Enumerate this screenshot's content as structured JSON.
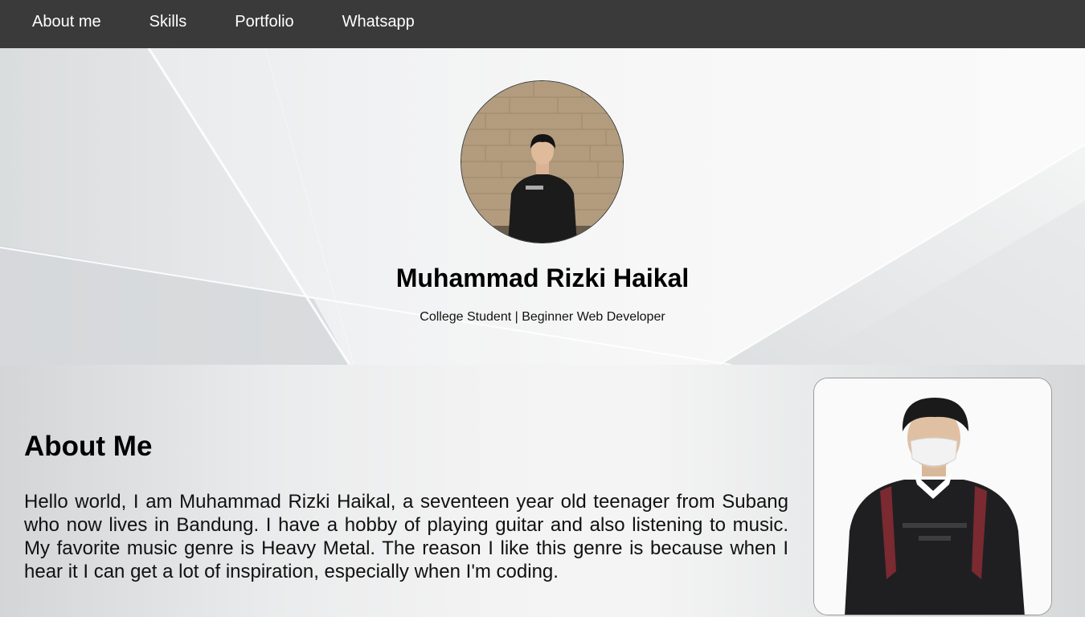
{
  "nav": {
    "items": [
      {
        "label": "About me"
      },
      {
        "label": "Skills"
      },
      {
        "label": "Portfolio"
      },
      {
        "label": "Whatsapp"
      }
    ]
  },
  "hero": {
    "name": "Muhammad Rizki Haikal",
    "tagline": "College Student | Beginner Web Developer"
  },
  "about": {
    "title": "About Me",
    "text": "Hello world, I am Muhammad Rizki Haikal, a seventeen year old teenager from Subang who now lives in Bandung. I have a hobby of playing guitar and also listening to music. My favorite music genre is Heavy Metal. The reason I like this genre is because when I hear it I can get a lot of inspiration, especially when I'm coding."
  },
  "colors": {
    "navbar": "#3a3a3a",
    "nav_text": "#ffffff",
    "text": "#000000"
  }
}
